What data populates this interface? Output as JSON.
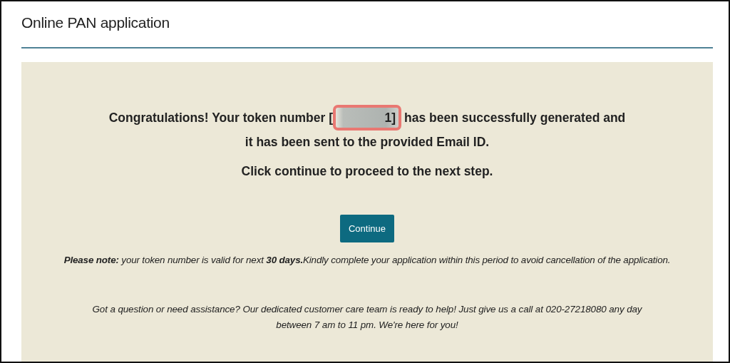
{
  "page": {
    "title": "Online PAN application"
  },
  "message": {
    "lead": "Congratulations! Your token number [",
    "token": {
      "visible_end": "1]",
      "redacted": true
    },
    "rest": "has been successfully generated and",
    "line_2": "it has been sent to the provided Email ID.",
    "instruction": "Click continue to proceed to the next step."
  },
  "button": {
    "label": "Continue"
  },
  "note": "**Please note:** your token number is valid for next **30 days.**Kindly complete your application within this period to avoid cancellation of the application.",
  "help": [
    "Got a question or need assistance? Our dedicated customer care team is ready to help! Just give us a call at 020-27218080 any day",
    "between 7 am to 11 pm. We're here for you!"
  ]
}
